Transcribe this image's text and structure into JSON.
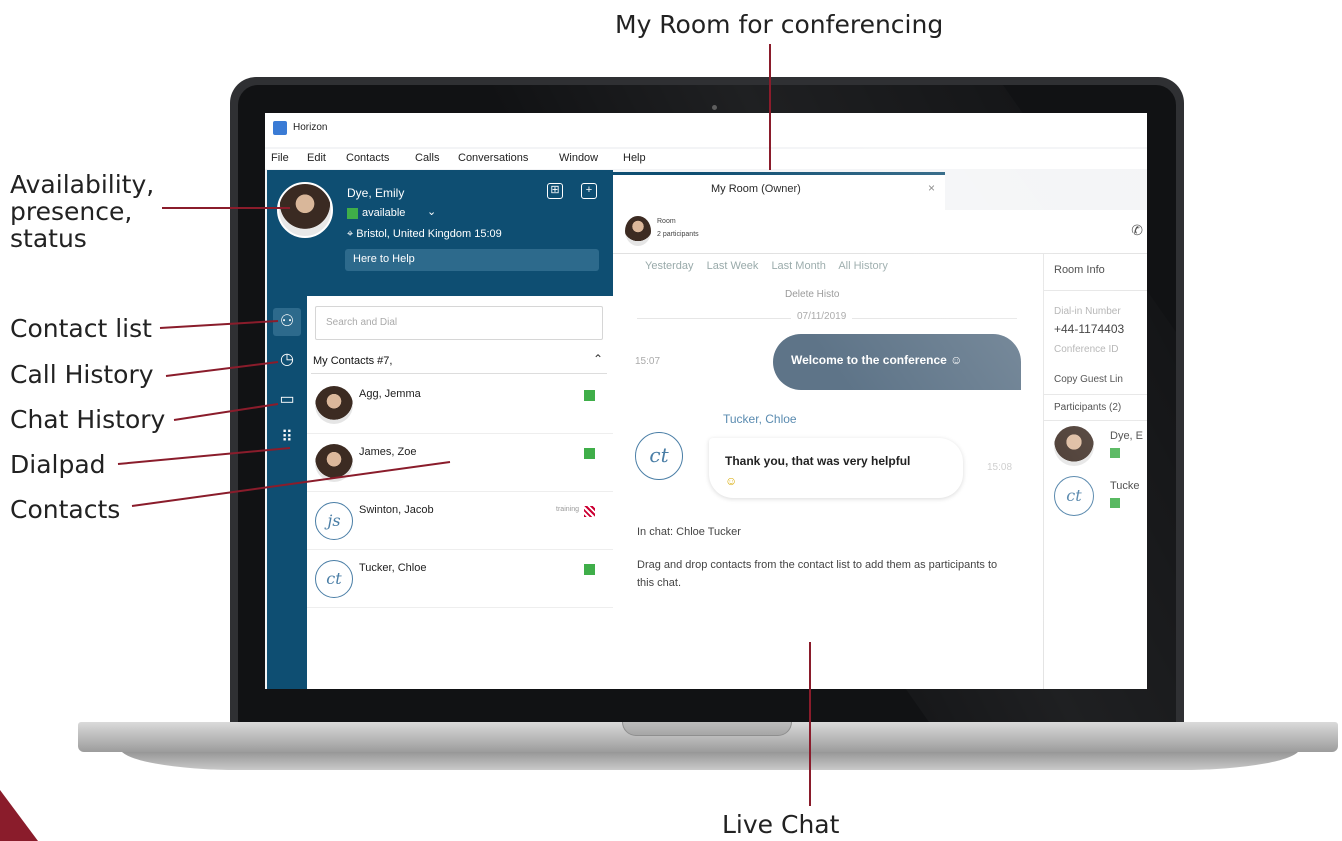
{
  "callouts": {
    "my_room": "My Room for conferencing",
    "availability_lines": [
      "Availability,",
      "presence,",
      "status"
    ],
    "contact_list": "Contact list",
    "call_history": "Call History",
    "chat_history": "Chat History",
    "dialpad": "Dialpad",
    "contacts": "Contacts",
    "live_chat": "Live Chat"
  },
  "colors": {
    "accent": "#8a1c2b",
    "app_blue": "#0e4e72",
    "available": "#3fae49"
  },
  "app": {
    "title": "Horizon",
    "menu": [
      "File",
      "Edit",
      "Contacts",
      "Calls",
      "Conversations",
      "Window",
      "Help"
    ]
  },
  "profile": {
    "name": "Dye, Emily",
    "presence": "available",
    "location": "⌖ Bristol, United Kingdom  15:09",
    "status_message": "Here to Help"
  },
  "contacts": {
    "search_placeholder": "Search and Dial",
    "group_title": "My Contacts #7,",
    "items": [
      {
        "name": "Agg, Jemma",
        "status": "available",
        "avatar": "photo"
      },
      {
        "name": "James, Zoe",
        "status": "available",
        "avatar": "photo"
      },
      {
        "name": "Swinton, Jacob",
        "status": "training",
        "status_text": "training",
        "avatar": "initials",
        "initials": "js"
      },
      {
        "name": "Tucker, Chloe",
        "status": "available",
        "avatar": "initials",
        "initials": "ct"
      }
    ]
  },
  "room": {
    "tab_title": "My Room (Owner)",
    "label": "Room",
    "participants": "2 participants",
    "filters": [
      "Yesterday",
      "Last Week",
      "Last Month",
      "All History"
    ],
    "delete_history": "Delete Histo",
    "date": "07/11/2019",
    "msg_out_time": "15:07",
    "msg_out": "Welcome to the conference ☺",
    "sender": "Tucker, Chloe",
    "sender_initials": "ct",
    "msg_in": "Thank you, that was very helpful",
    "msg_in_emoji": "☺",
    "msg_in_time": "15:08",
    "system_1": "In chat: Chloe Tucker",
    "system_2": "Drag and drop contacts from the contact list to add them as participants to this chat."
  },
  "room_info": {
    "title": "Room Info",
    "dial_in_label": "Dial-in Number",
    "dial_in_value": "+44-1174403",
    "conference_id_label": "Conference ID",
    "copy_guest_link": "Copy Guest Lin",
    "participants_title": "Participants (2)",
    "participants": [
      {
        "name": "Dye, E",
        "avatar": "photo"
      },
      {
        "name": "Tucke",
        "avatar": "initials",
        "initials": "ct"
      }
    ]
  }
}
